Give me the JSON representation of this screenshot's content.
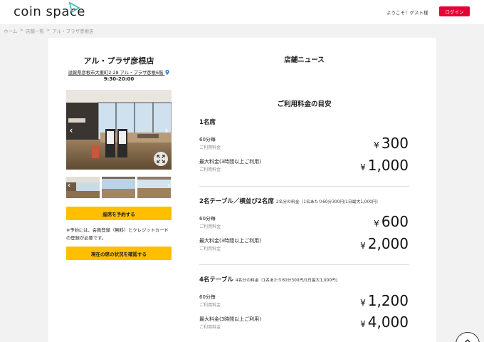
{
  "header": {
    "logo_text": "coin space",
    "welcome": "ようこそ！ゲスト様",
    "login_label": "ログイン",
    "accent_color": "#e60033"
  },
  "breadcrumb": [
    "ホーム",
    "店舗一覧",
    "アル・プラザ彦根店"
  ],
  "store": {
    "name": "アル・プラザ彦根店",
    "address": "滋賀県彦根市大東町2-28 アル・プラザ彦根6階",
    "hours": "9:30-20:00",
    "reserve_label": "座席を予約する",
    "note": "※予約には、会員登録（無料）とクレジットカードの登録が必要です。",
    "status_label": "現在の席の状況を確認する",
    "button_color": "#ffbf00"
  },
  "news": {
    "title": "店舗ニュース"
  },
  "pricing": {
    "title": "ご利用料金の目安",
    "sections": [
      {
        "title": "1名席",
        "subtitle": "",
        "rows": [
          {
            "label": "60分毎",
            "sub": "ご利用料金",
            "currency": "¥",
            "price": "300"
          },
          {
            "label": "最大料金(3時間以上ご利用)",
            "sub": "ご利用料金",
            "currency": "¥",
            "price": "1,000"
          }
        ]
      },
      {
        "title": "2名テーブル／横並び2名席",
        "subtitle": "2名分の料金（1名あたり60分300円/1日最大1,000円）",
        "rows": [
          {
            "label": "60分毎",
            "sub": "ご利用料金",
            "currency": "¥",
            "price": "600"
          },
          {
            "label": "最大料金(3時間以上ご利用)",
            "sub": "ご利用料金",
            "currency": "¥",
            "price": "2,000"
          }
        ]
      },
      {
        "title": "4名テーブル",
        "subtitle": "4名分の料金（1名あたり60分300円/1日最大1,000円)",
        "rows": [
          {
            "label": "60分毎",
            "sub": "ご利用料金",
            "currency": "¥",
            "price": "1,200"
          },
          {
            "label": "最大料金(3時間以上ご利用)",
            "sub": "ご利用料金",
            "currency": "¥",
            "price": "4,000"
          }
        ]
      }
    ]
  },
  "icons": {
    "pin": "map-pin-icon",
    "expand": "expand-icon",
    "prev": "chevron-left-icon",
    "next": "chevron-right-icon",
    "fab": "chevron-up-icon"
  }
}
